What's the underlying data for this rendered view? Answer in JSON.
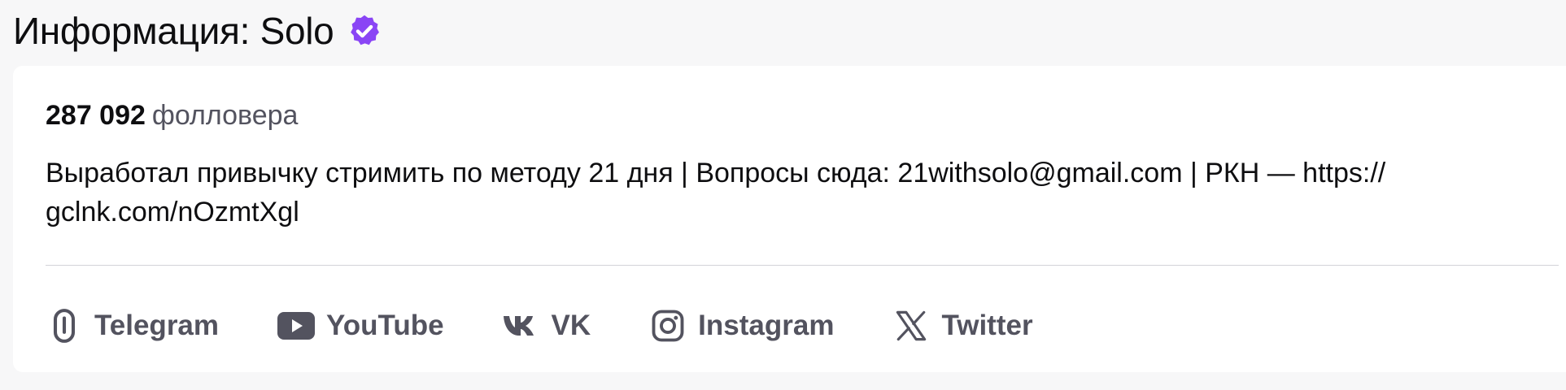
{
  "header": {
    "title": "Информация: Solo",
    "verified_icon": "verified-badge-icon",
    "verified_color": "#8a45f5"
  },
  "about": {
    "followers_count": "287 092",
    "followers_label": "фолловера",
    "bio": "Выработал привычку стримить по методу 21 дня | Вопросы сюда: 21withsolo@gmail.com | РКН — https:// gclnk.com/nOzmtXgl"
  },
  "social_links": [
    {
      "label": "Telegram",
      "icon": "link-icon"
    },
    {
      "label": "YouTube",
      "icon": "youtube-icon"
    },
    {
      "label": "VK",
      "icon": "vk-icon"
    },
    {
      "label": "Instagram",
      "icon": "instagram-icon"
    },
    {
      "label": "Twitter",
      "icon": "x-twitter-icon"
    }
  ],
  "colors": {
    "background": "#f7f7f8",
    "card": "#ffffff",
    "text_primary": "#0e0e10",
    "text_secondary": "#53535f",
    "accent": "#8a45f5"
  }
}
